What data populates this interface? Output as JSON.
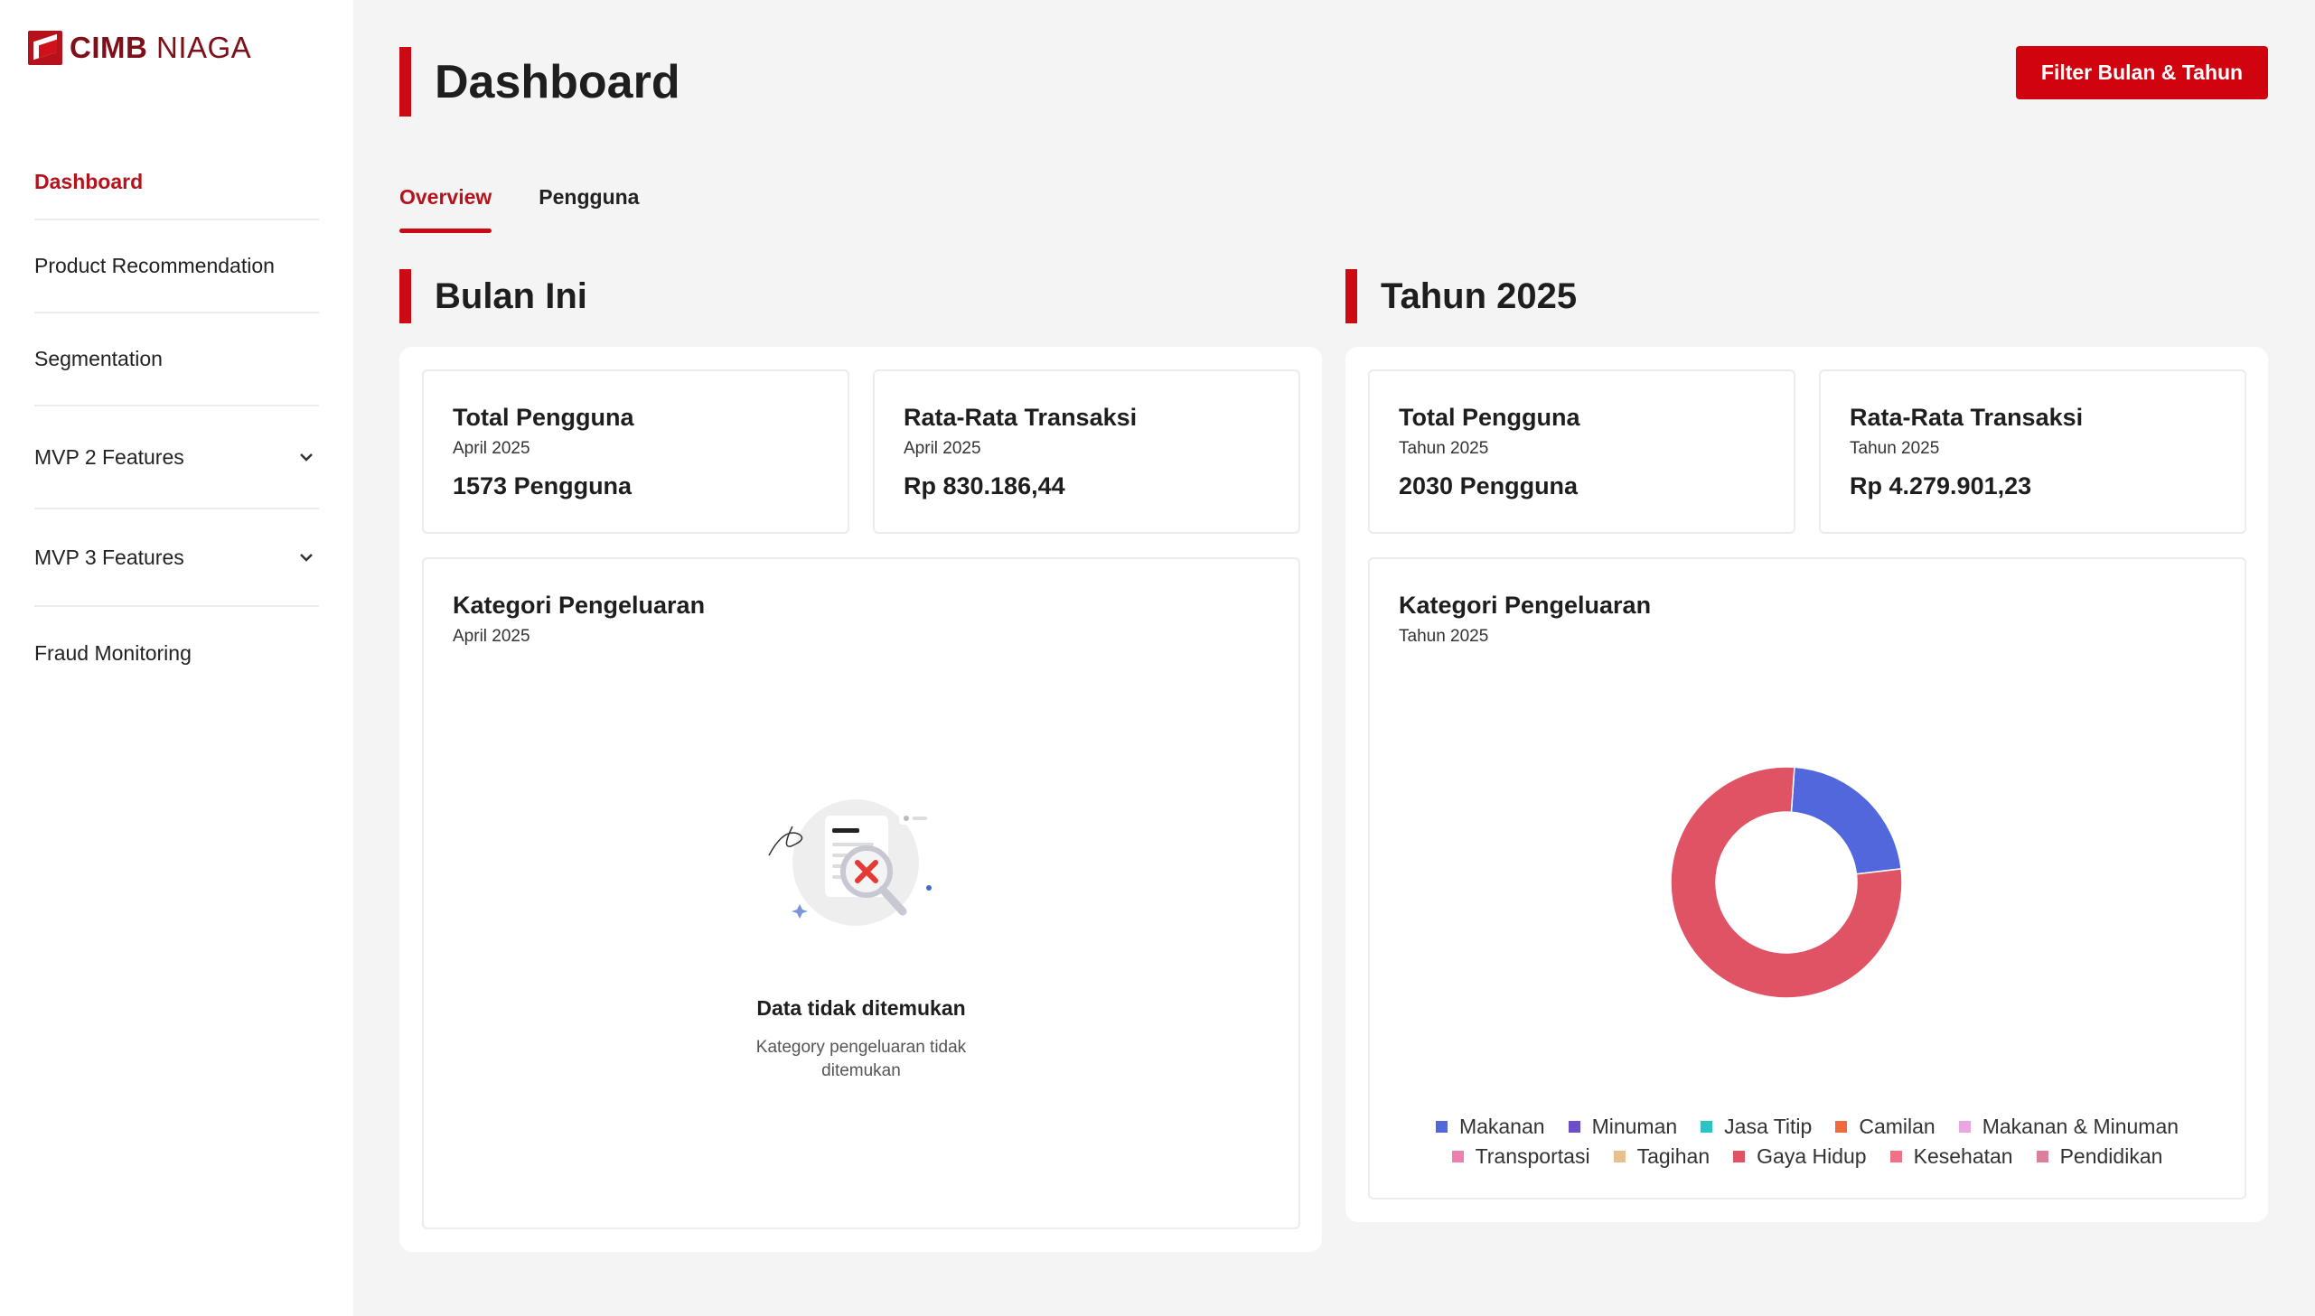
{
  "brand": {
    "name_bold": "CIMB",
    "name_light": "NIAGA"
  },
  "sidebar": {
    "items": [
      {
        "label": "Dashboard"
      },
      {
        "label": "Product Recommendation"
      },
      {
        "label": "Segmentation"
      },
      {
        "label": "MVP 2 Features"
      },
      {
        "label": "MVP 3 Features"
      },
      {
        "label": "Fraud Monitoring"
      }
    ]
  },
  "header": {
    "title": "Dashboard",
    "filter_label": "Filter Bulan & Tahun"
  },
  "tabs": [
    {
      "label": "Overview"
    },
    {
      "label": "Pengguna"
    }
  ],
  "month": {
    "title": "Bulan Ini",
    "total_users": {
      "title": "Total Pengguna",
      "period": "April 2025",
      "value": "1573 Pengguna"
    },
    "avg_tx": {
      "title": "Rata-Rata Transaksi",
      "period": "April 2025",
      "value": "Rp 830.186,44"
    },
    "category": {
      "title": "Kategori Pengeluaran",
      "period": "April 2025",
      "empty_title": "Data tidak ditemukan",
      "empty_desc": "Kategory pengeluaran tidak ditemukan"
    }
  },
  "year": {
    "title": "Tahun 2025",
    "total_users": {
      "title": "Total Pengguna",
      "period": "Tahun 2025",
      "value": "2030 Pengguna"
    },
    "avg_tx": {
      "title": "Rata-Rata Transaksi",
      "period": "Tahun 2025",
      "value": "Rp 4.279.901,23"
    },
    "category": {
      "title": "Kategori Pengeluaran",
      "period": "Tahun 2025"
    }
  },
  "chart_data": {
    "type": "pie",
    "title": "Kategori Pengeluaran",
    "donut": true,
    "legend_position": "bottom",
    "series": [
      {
        "name": "Makanan",
        "value": 22,
        "color": "#5267dc"
      },
      {
        "name": "Minuman",
        "value": 0,
        "color": "#6b4fc9"
      },
      {
        "name": "Jasa Titip",
        "value": 0,
        "color": "#2cc3c5"
      },
      {
        "name": "Camilan",
        "value": 0,
        "color": "#ef6a3c"
      },
      {
        "name": "Makanan & Minuman",
        "value": 0,
        "color": "#e7a8e0"
      },
      {
        "name": "Transportasi",
        "value": 0,
        "color": "#ee7fb1"
      },
      {
        "name": "Tagihan",
        "value": 0,
        "color": "#e8c08e"
      },
      {
        "name": "Gaya Hidup",
        "value": 78,
        "color": "#e05365"
      },
      {
        "name": "Kesehatan",
        "value": 0,
        "color": "#f0708a"
      },
      {
        "name": "Pendidikan",
        "value": 0,
        "color": "#d9809a"
      }
    ]
  }
}
